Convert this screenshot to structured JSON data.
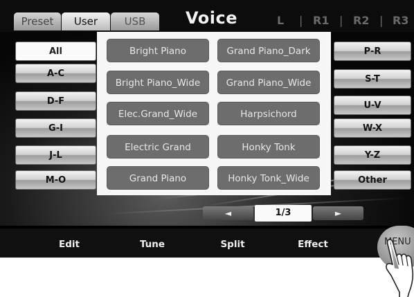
{
  "tabs": [
    {
      "label": "Preset"
    },
    {
      "label": "User"
    },
    {
      "label": "USB"
    }
  ],
  "title": "Voice",
  "parts": [
    "L",
    "R1",
    "R2",
    "R3"
  ],
  "left_categories": [
    "All",
    "A-C",
    "D-F",
    "G-I",
    "J-L",
    "M-O"
  ],
  "right_categories": [
    "P-R",
    "S-T",
    "U-V",
    "W-X",
    "Y-Z",
    "Other"
  ],
  "voices": [
    "Bright Piano",
    "Grand Piano_Dark",
    "Bright Piano_Wide",
    "Grand Piano_Wide",
    "Elec.Grand_Wide",
    "Harpsichord",
    "Electric Grand",
    "Honky Tonk",
    "Grand Piano",
    "Honky Tonk_Wide"
  ],
  "pager": {
    "prev": "◄",
    "page": "1/3",
    "next": "►"
  },
  "functions": [
    "Edit",
    "Tune",
    "Split",
    "Effect"
  ],
  "menu_label": "MENU"
}
